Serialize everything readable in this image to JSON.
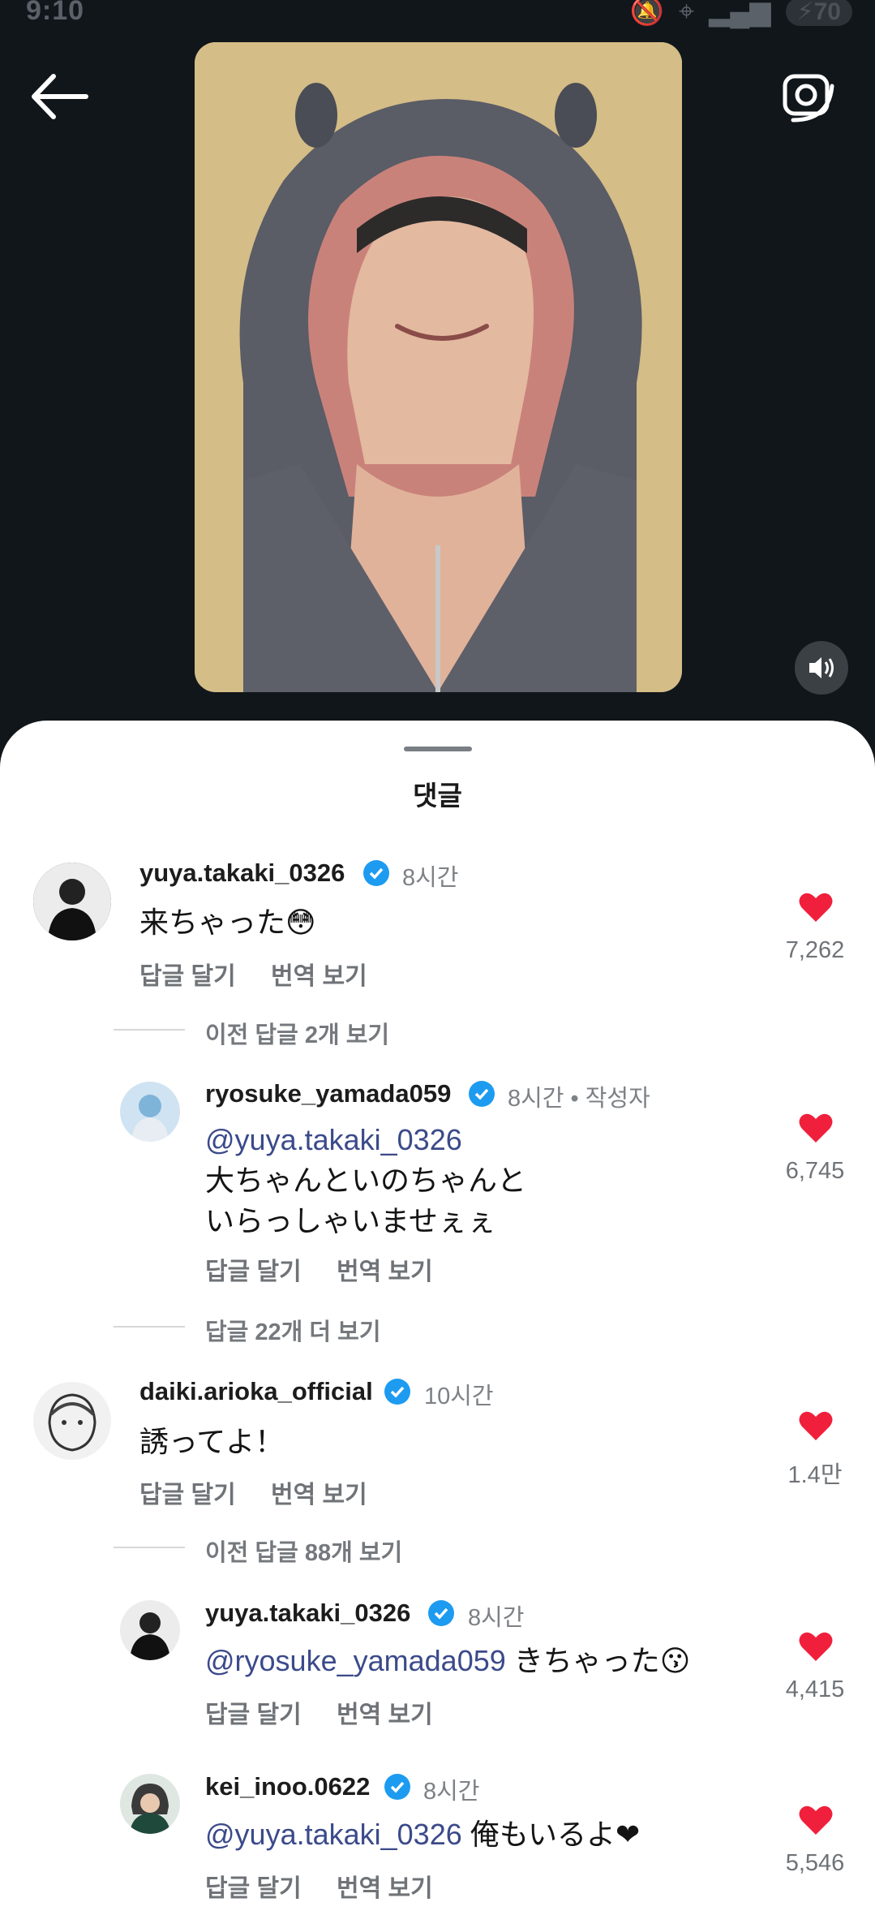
{
  "status_bar": {
    "time": "9:10",
    "battery": "70"
  },
  "sheet": {
    "title": "댓글"
  },
  "actions": {
    "reply": "답글 달기",
    "translate": "번역 보기"
  },
  "comments": [
    {
      "username": "yuya.takaki_0326",
      "time": "8시간",
      "text": "来ちゃった😳",
      "likes": "7,262"
    },
    {
      "more": "이전 답글 2개 보기"
    },
    {
      "username": "ryosuke_yamada059",
      "time": "8시간 • 작성자",
      "mention": "@yuya.takaki_0326",
      "line1": "大ちゃんといのちゃんと",
      "line2": "いらっしゃいませぇぇ",
      "likes": "6,745"
    },
    {
      "more": "답글 22개 더 보기"
    },
    {
      "username": "daiki.arioka_official",
      "time": "10시간",
      "text": "誘ってよ！",
      "likes": "1.4만"
    },
    {
      "more": "이전 답글 88개 보기"
    },
    {
      "username": "yuya.takaki_0326",
      "time": "8시간",
      "mention": "@ryosuke_yamada059",
      "text": " きちゃった😗",
      "likes": "4,415"
    },
    {
      "username": "kei_inoo.0622",
      "time": "8시간",
      "mention": "@yuya.takaki_0326",
      "text": " 俺もいるよ❤",
      "likes": "5,546"
    }
  ],
  "colors": {
    "heart": "#f0203c",
    "verified": "#1d9bf0",
    "background": "#11161b",
    "mention": "#3b4a8a"
  }
}
